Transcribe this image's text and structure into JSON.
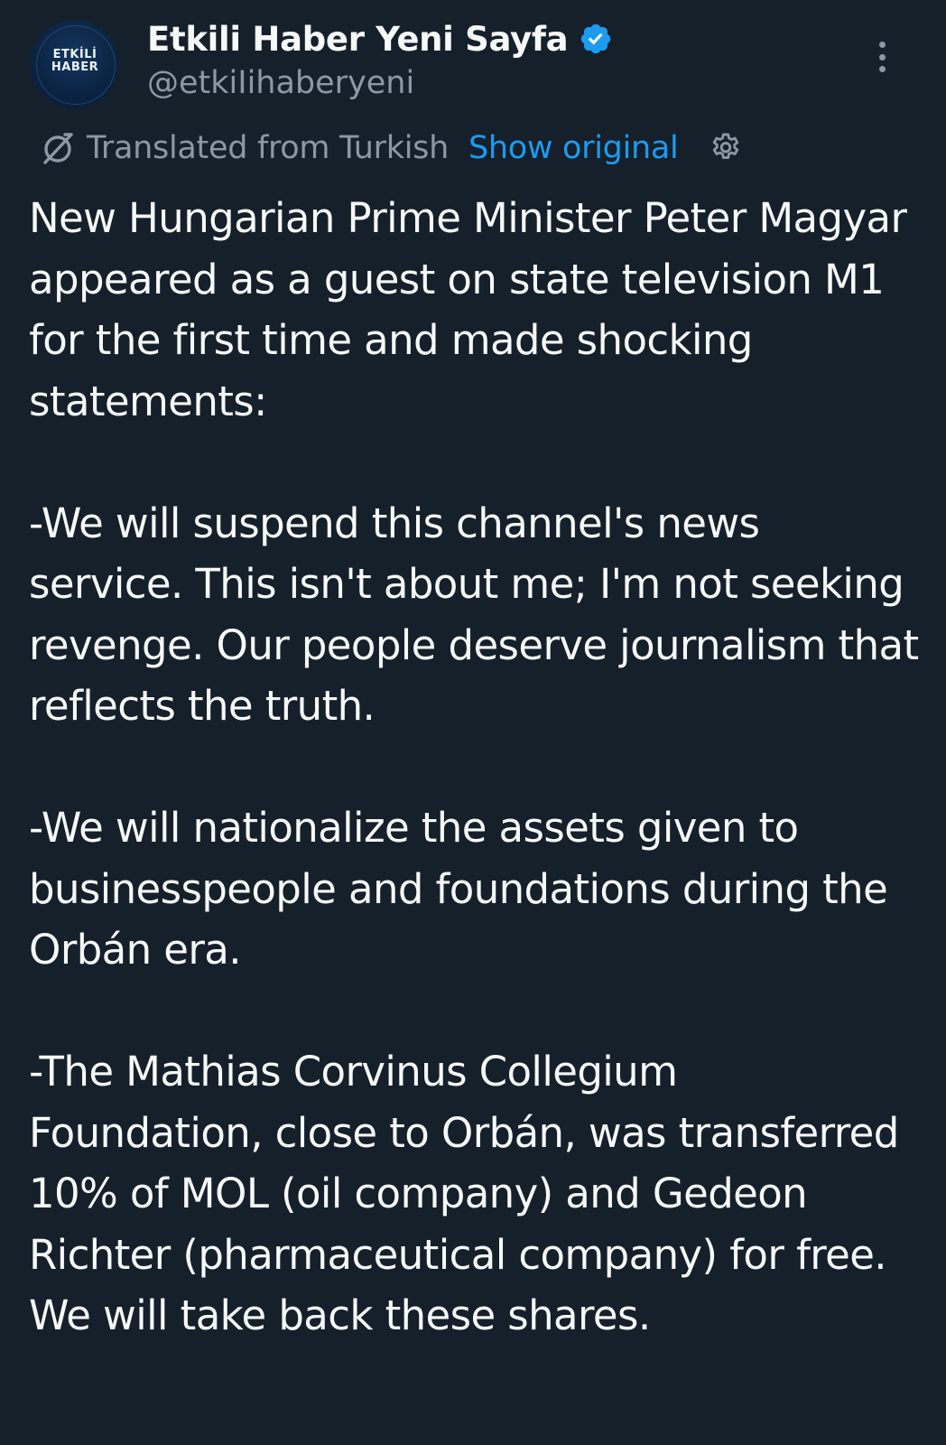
{
  "author": {
    "avatar_text_line1": "ETKİLİ",
    "avatar_text_line2": "HABER",
    "name": "Etkili Haber Yeni Sayfa",
    "handle": "@etkiIihaberyeni",
    "verified_icon": "verified-badge-icon"
  },
  "translation": {
    "label": "Translated from Turkish",
    "show_original": "Show original",
    "translate_icon": "translate-icon",
    "settings_icon": "gear-icon"
  },
  "tweet": {
    "paragraphs": [
      "New Hungarian Prime Minister Peter Magyar appeared as a guest on state television M1 for the first time and made shocking statements:",
      "-We will suspend this channel's news service. This isn't about me; I'm not seeking revenge. Our people deserve journalism that reflects the truth.",
      "-We will nationalize the assets given to businesspeople and foundations during the Orbán era.",
      "-The Mathias Corvinus Collegium Foundation, close to Orbán, was transferred 10% of MOL (oil company) and Gedeon Richter (pharmaceutical company) for free. We will take back these shares."
    ]
  },
  "colors": {
    "background": "#15202b",
    "text": "#f7f9f9",
    "secondary": "#8b98a5",
    "accent": "#1d9bf0"
  }
}
